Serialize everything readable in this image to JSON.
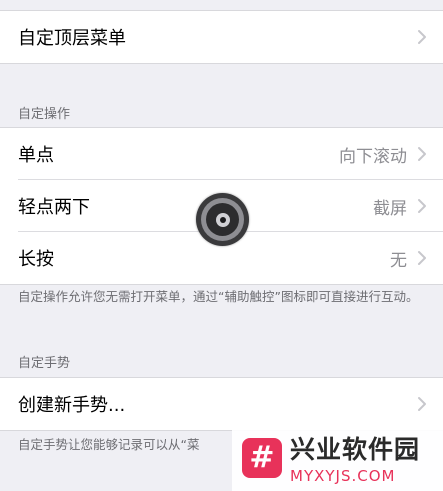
{
  "top_group": {
    "items": [
      {
        "label": "自定顶层菜单",
        "value": ""
      }
    ]
  },
  "custom_actions": {
    "header": "自定操作",
    "items": [
      {
        "label": "单点",
        "value": "向下滚动"
      },
      {
        "label": "轻点两下",
        "value": "截屏"
      },
      {
        "label": "长按",
        "value": "无"
      }
    ],
    "footer": "自定操作允许您无需打开菜单，通过“辅助触控”图标即可直接进行互动。"
  },
  "custom_gestures": {
    "header": "自定手势",
    "items": [
      {
        "label": "创建新手势...",
        "value": ""
      }
    ],
    "footer": "自定手势让您能够记录可以从“菜"
  },
  "assistive_touch": {
    "icon": "assistive-touch-icon"
  },
  "watermark": {
    "logo_glyph": "#",
    "title": "兴业软件园",
    "subtitle": "MYXYJS.COM"
  },
  "colors": {
    "background": "#efeff4",
    "secondary_text": "#8e8e93",
    "watermark_accent": "#e8325a"
  }
}
